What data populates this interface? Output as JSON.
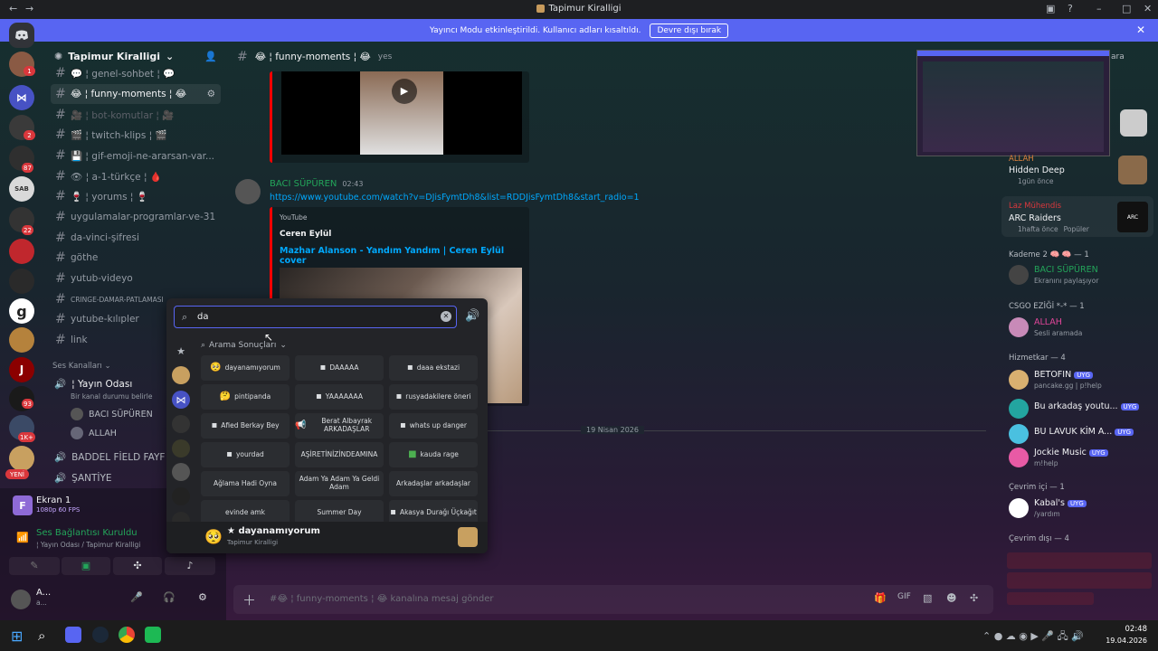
{
  "window": {
    "title": "Tapimur Kiralligi"
  },
  "banner": {
    "text": "Yayıncı Modu etkinleştirildi. Kullanıcı adları kısaltıldı.",
    "button": "Devre dışı bırak"
  },
  "server": {
    "name": "Tapimur Kiralligi"
  },
  "rail_badges": [
    "1",
    "2",
    "87",
    "22",
    "93",
    "1K+"
  ],
  "rail_new": "YENİ",
  "channels": [
    {
      "label": "genel-sohbet",
      "decor": "💬 ¦ genel-sohbet ¦ 💬"
    },
    {
      "label": "😂 ¦ funny-moments ¦ 😂"
    },
    {
      "label": "🎥 ¦ bot-komutlar ¦ 🎥"
    },
    {
      "label": "🎬 ¦ twitch-klips ¦ 🎬"
    },
    {
      "label": "💾 ¦ gif-emoji-ne-ararsan-var..."
    },
    {
      "label": "👁 ¦ a-1-türkçe ¦ 🩸"
    },
    {
      "label": "🍷 ¦ yorums ¦ 🍷"
    },
    {
      "label": "uygulamalar-programlar-ve-31"
    },
    {
      "label": "da-vinci-şifresi"
    },
    {
      "label": "göthe"
    },
    {
      "label": "yutub-videyo"
    },
    {
      "label": "CRINGE-DAMAR-PATLAMASI"
    },
    {
      "label": "yutube-kılıpler"
    },
    {
      "label": "link"
    }
  ],
  "voice": {
    "category": "Ses Kanalları",
    "channel": "¦ Yayın Odası",
    "status": "Bir kanal durumu belirle",
    "users": [
      "BACI SÜPÜREN",
      "ALLAH"
    ],
    "others": [
      "BADDEL FİELD FAYF",
      "ŞANTİYE"
    ]
  },
  "stream": {
    "title": "Ekran 1",
    "quality": "1080p 60 FPS"
  },
  "connection": {
    "title": "Ses Bağlantısı Kuruldu",
    "sub": "¦ Yayın Odası / Tapimur Kiralligi"
  },
  "user": {
    "name": "A...",
    "sub": "a..."
  },
  "chat": {
    "channel": "😂 ¦ funny-moments ¦ 😂",
    "topic": "yes",
    "partial": "ara"
  },
  "message": {
    "author": "BACI SÜPÜREN",
    "time": "02:43",
    "link": "https://www.youtube.com/watch?v=DJisFymtDh8&list=RDDJisFymtDh8&start_radio=1",
    "provider": "YouTube",
    "channel": "Ceren Eylül",
    "title": "Mazhar Alanson - Yandım Yandım | Ceren Eylül cover"
  },
  "divider": "19 Nisan 2026",
  "composer": {
    "placeholder": "#😂 ¦ funny-moments ¦ 😂 kanalına mesaj gönder"
  },
  "picker": {
    "query": "da",
    "section": "Arama Sonuçları",
    "stickers": [
      [
        "dayanamıyorum",
        "DAAAAA",
        "daaa ekstazi"
      ],
      [
        "pintipanda",
        "YAAAAAAA",
        "rusyadakilere öneri"
      ],
      [
        "Afied Berkay Bey",
        "Berat Albayrak ARKADAŞLAR",
        "whats up danger"
      ],
      [
        "yourdad",
        "AŞİRETİNİZİNDEAMINA",
        "kauda rage"
      ],
      [
        "Ağlama Hadi Oyna",
        "Adam Ya Adam Ya Geldi Adam",
        "Arkadaşlar arkadaşlar"
      ],
      [
        "evinde amk",
        "Summer Day",
        "Akasya Durağı Üçkağıt"
      ]
    ],
    "preview_name": "★ dayanamıyorum",
    "preview_server": "Tapimur Kiralligi"
  },
  "members": {
    "activity1": {
      "name": "ALLAH",
      "game": "Hidden Deep",
      "time": "1gün önce"
    },
    "activity2": {
      "name": "Laz Mühendis",
      "game": "ARC Raiders",
      "time": "1hafta önce",
      "tag": "Popüler"
    },
    "sec1": "Kademe 2 🧠 🧠 — 1",
    "u1": {
      "name": "BACI SÜPÜREN",
      "status": "Ekranını paylaşıyor"
    },
    "sec2": "CSGO EZİĞİ *-* — 1",
    "u2": {
      "name": "ALLAH",
      "status": "Sesli aramada"
    },
    "sec3": "Hizmetkar — 4",
    "bots": [
      {
        "name": "BETOFIN",
        "tag": "UYG",
        "status": "pancake.gg | p!help"
      },
      {
        "name": "Bu arkadaş youtu...",
        "tag": "UYG",
        "status": ""
      },
      {
        "name": "BU LAVUK KİM A...",
        "tag": "UYG",
        "status": ""
      },
      {
        "name": "Jockie Music",
        "tag": "UYG",
        "status": "m!help"
      }
    ],
    "sec4": "Çevrim içi — 1",
    "u3": {
      "name": "Kabal's",
      "tag": "UYG",
      "status": "/yardım"
    },
    "sec5": "Çevrim dışı — 4"
  },
  "clock": {
    "time": "02:48",
    "date": "19.04.2026"
  }
}
